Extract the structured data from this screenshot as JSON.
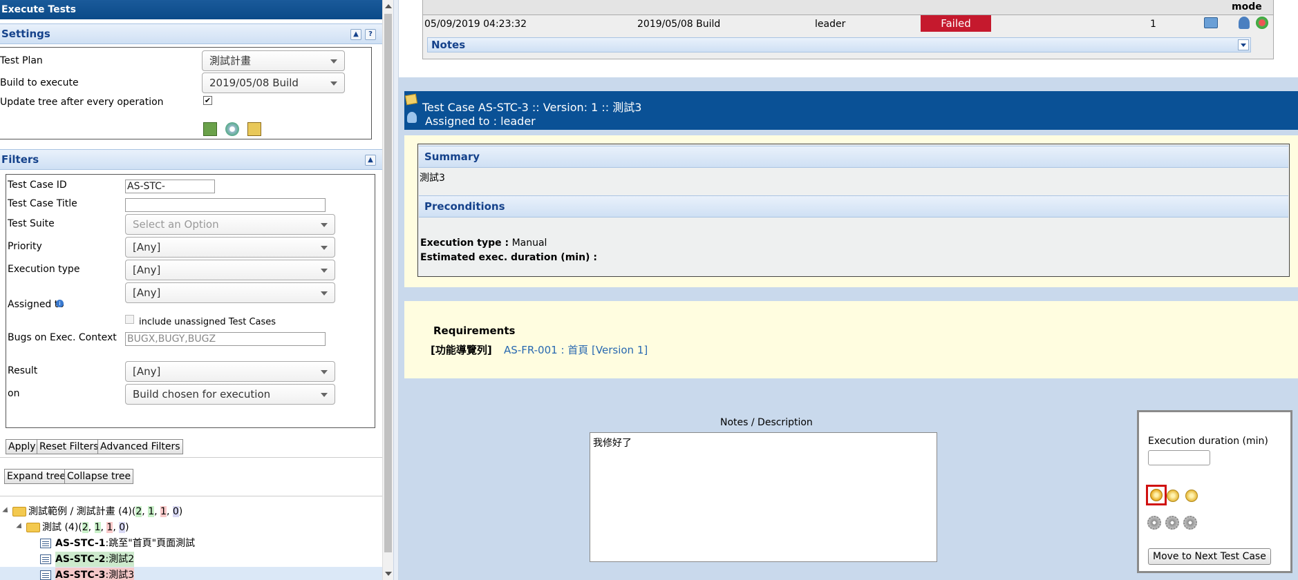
{
  "left_panel": {
    "title": "Execute Tests",
    "settings": {
      "heading": "Settings",
      "help_label": "?",
      "test_plan_label": "Test Plan",
      "test_plan_value": "測試計畫",
      "build_label": "Build to execute",
      "build_value": "2019/05/08 Build",
      "update_tree_label": "Update tree after every operation",
      "update_tree_checked": true
    },
    "filters": {
      "heading": "Filters",
      "test_case_id_label": "Test Case ID",
      "test_case_id_value": "AS-STC-",
      "test_case_title_label": "Test Case Title",
      "test_case_title_value": "",
      "test_suite_label": "Test Suite",
      "test_suite_placeholder": "Select an Option",
      "priority_label": "Priority",
      "priority_value": "[Any]",
      "execution_type_label": "Execution type",
      "execution_type_value": "[Any]",
      "assigned_to_label": "Assigned to",
      "assigned_to_value": "[Any]",
      "include_unassigned_label": "include unassigned Test Cases",
      "bugs_label": "Bugs on Exec. Context",
      "bugs_placeholder": "BUGX,BUGY,BUGZ",
      "result_label": "Result",
      "result_value": "[Any]",
      "on_label": "on",
      "on_value": "Build chosen for execution"
    },
    "buttons": {
      "apply": "Apply",
      "reset": "Reset Filters",
      "advanced": "Advanced Filters",
      "expand": "Expand tree",
      "collapse": "Collapse tree"
    },
    "tree": {
      "root": {
        "label": "測試範例 / 測試計畫 (4)(",
        "c1": "2",
        "c2": "1",
        "c3": "1",
        "c4": "0",
        "close": ")"
      },
      "suite": {
        "label": "測試 (4)(",
        "c1": "2",
        "c2": "1",
        "c3": "1",
        "c4": "0",
        "close": ")"
      },
      "cases": [
        {
          "id": "AS-STC-1",
          "name": ":跳至\"首頁\"頁面測試"
        },
        {
          "id": "AS-STC-2",
          "name": ":測試2"
        },
        {
          "id": "AS-STC-3",
          "name": ":測試3"
        }
      ]
    }
  },
  "right_panel": {
    "exec_table": {
      "mode_header": "mode",
      "row": {
        "date": "05/09/2019 04:23:32",
        "build": "2019/05/08 Build",
        "tester": "leader",
        "status": "Failed",
        "version": "1"
      },
      "notes_label": "Notes"
    },
    "test_case_header": {
      "title": "Test Case AS-STC-3 :: Version: 1 :: 測試3",
      "assigned": "Assigned to : leader"
    },
    "summary": {
      "heading": "Summary",
      "text": "測試3",
      "preconditions_heading": "Preconditions",
      "execution_type_label": "Execution type :",
      "execution_type_value": " Manual",
      "estimated_label": "Estimated exec. duration (min) :"
    },
    "requirements": {
      "heading": "Requirements",
      "group": "[功能導覽列]",
      "link": "AS-FR-001 : 首頁 [Version 1]"
    },
    "notes_desc": {
      "label": "Notes / Description",
      "value": "我修好了"
    },
    "execution_box": {
      "duration_label": "Execution duration (min)",
      "duration_value": "",
      "move_next_button": "Move to Next Test Case"
    }
  },
  "colors": {
    "title_bar": "#0b4a88",
    "failed": "#c5192d",
    "highlight_border": "#d01010",
    "right_bg": "#c9d9ec",
    "yellow_card": "#fffde0"
  }
}
